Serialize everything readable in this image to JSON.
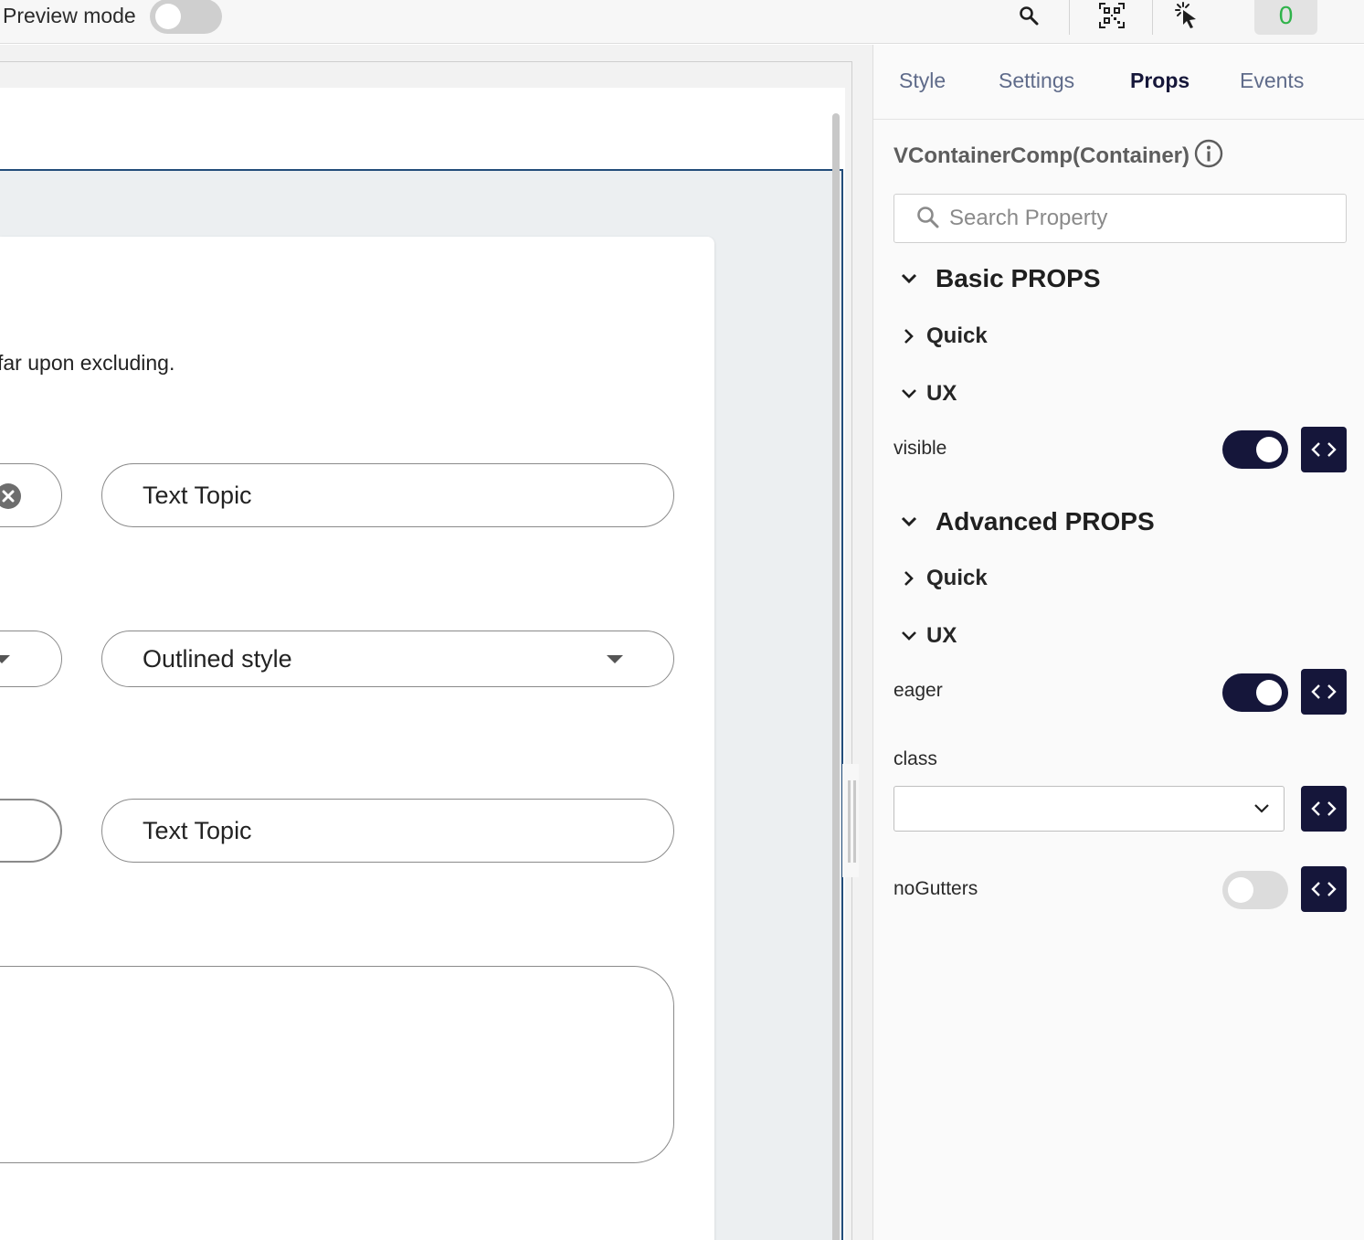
{
  "topbar": {
    "preview_label": "Preview mode",
    "preview_enabled": false,
    "icons": [
      "search-icon",
      "qr-code-icon",
      "cursor-click-icon"
    ],
    "counter": "0",
    "counter_color": "#2fb34a"
  },
  "canvas": {
    "body_text": "far upon excluding.",
    "fields": [
      {
        "label": "Text Topic",
        "type": "text"
      },
      {
        "label": "Outlined style",
        "type": "select"
      },
      {
        "label": "Text Topic",
        "type": "text"
      }
    ],
    "selection_color": "#234d7a"
  },
  "panel": {
    "tabs": [
      {
        "label": "Style",
        "active": false
      },
      {
        "label": "Settings",
        "active": false
      },
      {
        "label": "Props",
        "active": true
      },
      {
        "label": "Events",
        "active": false
      }
    ],
    "component_title": "VContainerComp(Container)",
    "search": {
      "placeholder": "Search Property",
      "value": ""
    },
    "basic": {
      "title": "Basic PROPS",
      "quick": "Quick",
      "ux": "UX",
      "visible": {
        "label": "visible",
        "value": true
      }
    },
    "advanced": {
      "title": "Advanced PROPS",
      "quick": "Quick",
      "ux": "UX",
      "eager": {
        "label": "eager",
        "value": true
      },
      "class": {
        "label": "class",
        "value": ""
      },
      "noGutters": {
        "label": "noGutters",
        "value": false
      }
    },
    "accent_color": "#15163a"
  }
}
